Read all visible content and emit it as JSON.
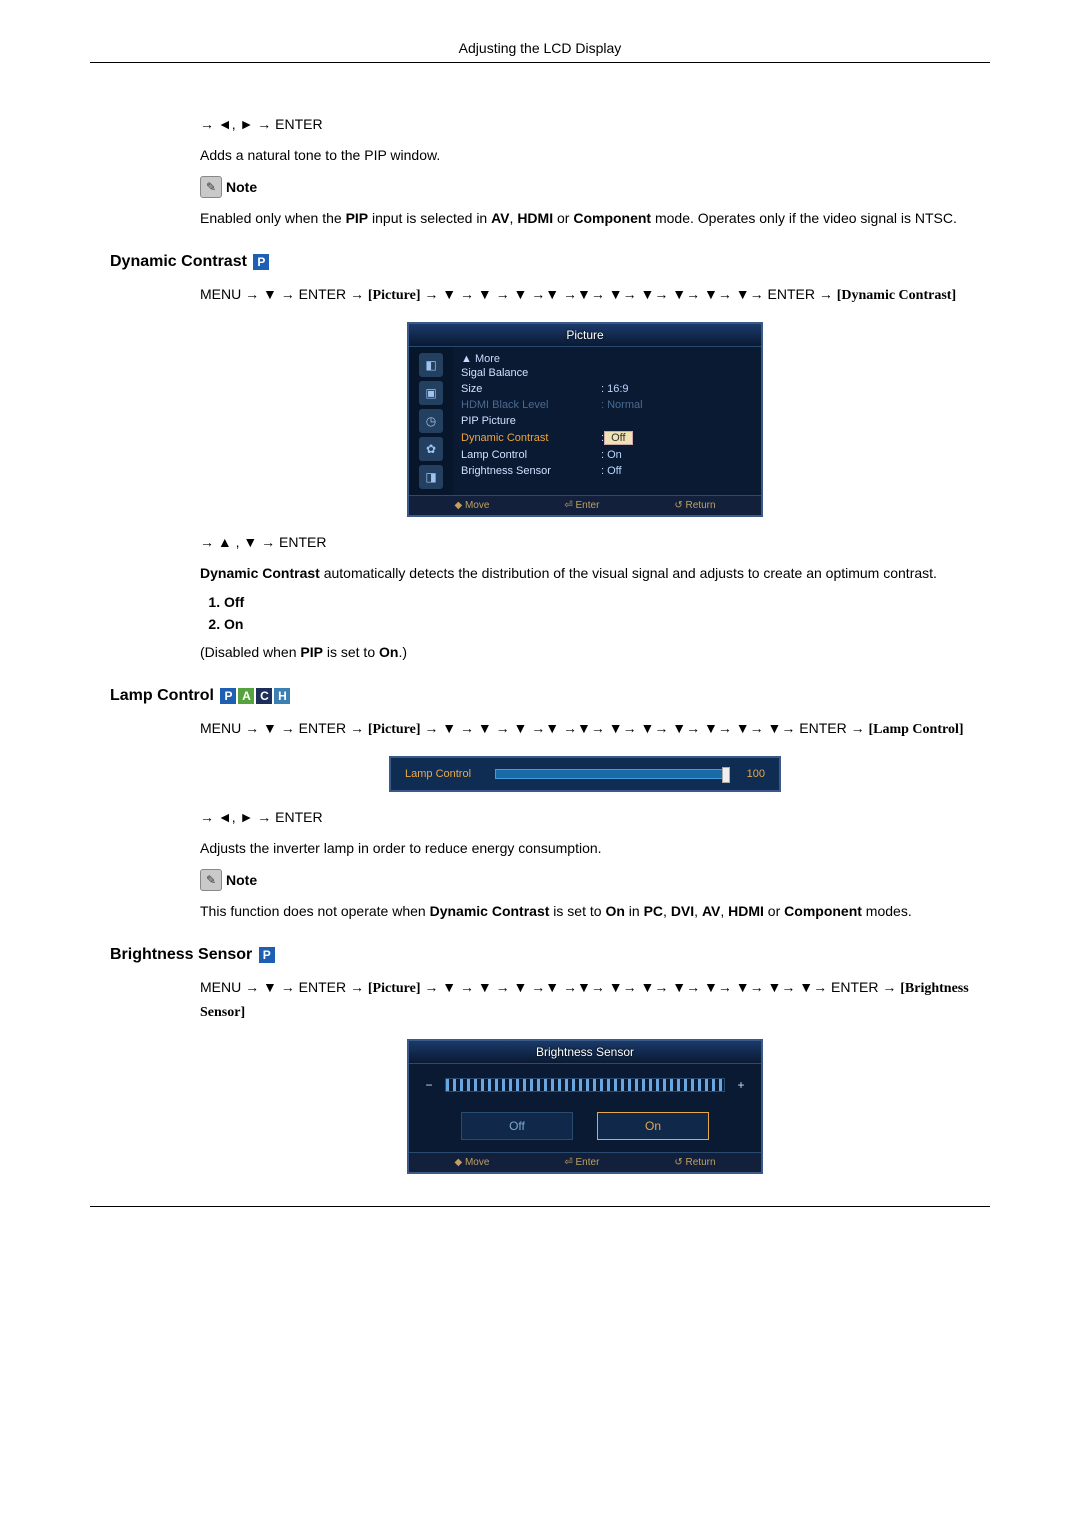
{
  "header": "Adjusting the LCD Display",
  "intro": {
    "nav": "→ ◄, ► → ENTER",
    "para": "Adds a natural tone to the PIP window.",
    "note_label": "Note",
    "note_text_parts": {
      "a": "Enabled only when the ",
      "b": "PIP",
      "c": " input is selected in ",
      "d": "AV",
      "e": ", ",
      "f": "HDMI",
      "g": " or ",
      "h": "Component",
      "i": " mode. Operates only if the video signal is NTSC."
    }
  },
  "dynamic_contrast": {
    "heading": "Dynamic Contrast",
    "nav_parts": {
      "a": "MENU → ▼ → ENTER → ",
      "b": "[Picture]",
      "c": " → ▼ → ▼ → ▼ →▼ →▼→ ▼→ ▼→ ▼→ ▼→ ▼→ ENTER → ",
      "d": "[Dynamic Contrast]"
    },
    "osd": {
      "title": "Picture",
      "more": "▲ More",
      "rows": [
        {
          "label": "Sigal Balance",
          "value": "",
          "dim": false,
          "hl": false
        },
        {
          "label": "Size",
          "value": ": 16:9",
          "dim": false,
          "hl": false
        },
        {
          "label": "HDMI Black Level",
          "value": ": Normal",
          "dim": true,
          "hl": false
        },
        {
          "label": "PIP Picture",
          "value": "",
          "dim": false,
          "hl": false
        },
        {
          "label": "Dynamic Contrast",
          "value": "Off",
          "dim": false,
          "hl": true
        },
        {
          "label": "Lamp Control",
          "value": ": On",
          "dim": false,
          "hl": false
        },
        {
          "label": "Brightness Sensor",
          "value": ": Off",
          "dim": false,
          "hl": false
        }
      ],
      "footer": {
        "move": "Move",
        "enter": "Enter",
        "ret": "Return"
      }
    },
    "nav2": "→ ▲ , ▼ → ENTER",
    "desc_parts": {
      "a": "Dynamic Contrast",
      "b": " automatically detects the distribution of the visual signal and adjusts to create an optimum contrast."
    },
    "options": [
      "Off",
      "On"
    ],
    "disabled_parts": {
      "a": "(Disabled when ",
      "b": "PIP",
      "c": " is set to ",
      "d": "On",
      "e": ".)"
    }
  },
  "lamp_control": {
    "heading": "Lamp Control",
    "nav_parts": {
      "a": "MENU → ▼ → ENTER → ",
      "b": "[Picture]",
      "c": " → ▼ → ▼ → ▼ →▼ →▼→ ▼→ ▼→ ▼→ ▼→ ▼→ ▼→ ENTER → ",
      "d": "[Lamp Control]"
    },
    "osd": {
      "label": "Lamp Control",
      "value": "100"
    },
    "nav2": "→ ◄, ► → ENTER",
    "desc": "Adjusts the inverter lamp in order to reduce energy consumption.",
    "note_label": "Note",
    "note_parts": {
      "a": "This function does not operate when ",
      "b": "Dynamic Contrast",
      "c": " is set to ",
      "d": "On",
      "e": " in ",
      "f": "PC",
      "g": ", ",
      "h": "DVI",
      "i": ", ",
      "j": "AV",
      "k": ", ",
      "l": "HDMI",
      "m": " or ",
      "n": "Component",
      "o": " modes."
    }
  },
  "brightness_sensor": {
    "heading": "Brightness Sensor",
    "nav_parts": {
      "a": "MENU → ▼ → ENTER → ",
      "b": "[Picture]",
      "c": " → ▼ → ▼ → ▼ →▼ →▼→ ▼→ ▼→ ▼→ ▼→ ▼→ ▼→ ▼→ ENTER → ",
      "d": "[Brightness Sensor]"
    },
    "osd": {
      "title": "Brightness Sensor",
      "minus": "−",
      "plus": "+",
      "off": "Off",
      "on": "On",
      "footer": {
        "move": "Move",
        "enter": "Enter",
        "ret": "Return"
      }
    }
  },
  "badges": {
    "P": "P",
    "A": "A",
    "C": "C",
    "H": "H"
  }
}
